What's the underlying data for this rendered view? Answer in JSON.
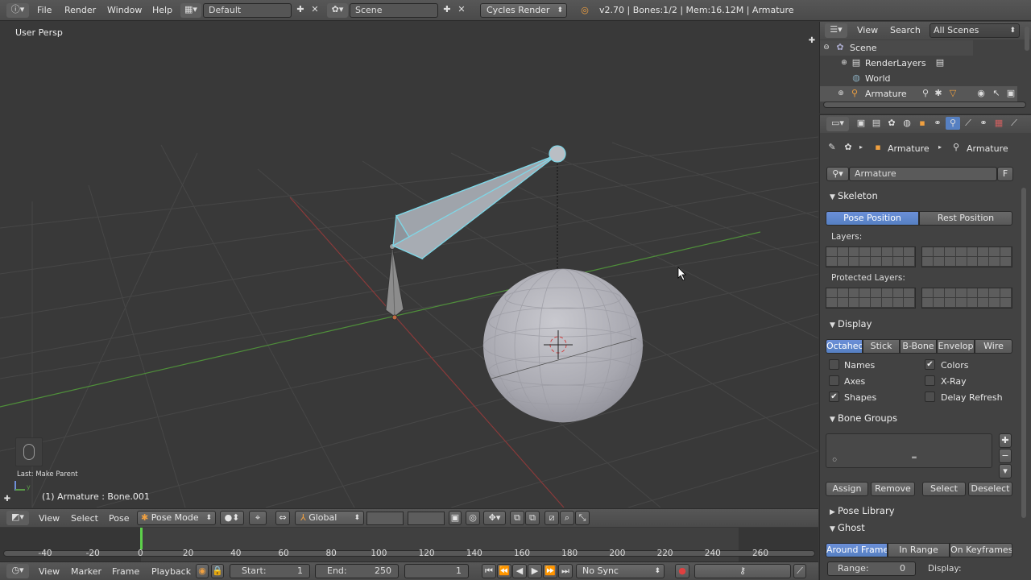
{
  "topbar": {
    "menus": [
      "File",
      "Render",
      "Window",
      "Help"
    ],
    "layout_name": "Default",
    "scene_name": "Scene",
    "render_engine": "Cycles Render",
    "stats": "v2.70 | Bones:1/2 | Mem:16.12M | Armature"
  },
  "viewport": {
    "view_label": "User Persp",
    "last_op": "Last: Make Parent",
    "object_info": "(1) Armature : Bone.001",
    "header": {
      "menus": [
        "View",
        "Select",
        "Pose"
      ],
      "mode": "Pose Mode",
      "orientation": "Global"
    }
  },
  "timeline": {
    "ticks": [
      "-40",
      "-20",
      "0",
      "20",
      "40",
      "60",
      "80",
      "100",
      "120",
      "140",
      "160",
      "180",
      "200",
      "220",
      "240",
      "260"
    ],
    "current_frame": 1,
    "menus": [
      "View",
      "Marker",
      "Frame",
      "Playback"
    ],
    "start_label": "Start:",
    "start_value": "1",
    "end_label": "End:",
    "end_value": "250",
    "frame_value": "1",
    "sync": "No Sync"
  },
  "outliner": {
    "menus": [
      "View",
      "Search"
    ],
    "filter": "All Scenes",
    "items": [
      "Scene",
      "RenderLayers",
      "World",
      "Armature"
    ]
  },
  "properties": {
    "breadcrumb": [
      "Armature",
      "Armature"
    ],
    "datablock_name": "Armature",
    "fake_user": "F",
    "skeleton": {
      "title": "Skeleton",
      "pose_position": "Pose Position",
      "rest_position": "Rest Position",
      "layers_label": "Layers:",
      "protected_label": "Protected Layers:"
    },
    "display": {
      "title": "Display",
      "types": [
        "Octahed",
        "Stick",
        "B-Bone",
        "Envelop",
        "Wire"
      ],
      "selected_type": "Octahed",
      "names": "Names",
      "axes": "Axes",
      "shapes": "Shapes",
      "colors": "Colors",
      "xray": "X-Ray",
      "delay_refresh": "Delay Refresh",
      "checked": {
        "names": false,
        "axes": false,
        "shapes": true,
        "colors": true,
        "xray": false,
        "delay_refresh": false
      }
    },
    "bone_groups": {
      "title": "Bone Groups",
      "assign": "Assign",
      "remove": "Remove",
      "select": "Select",
      "deselect": "Deselect"
    },
    "pose_library": {
      "title": "Pose Library"
    },
    "ghost": {
      "title": "Ghost",
      "modes": [
        "Around Frame",
        "In Range",
        "On Keyframes"
      ],
      "selected_mode": "Around Frame",
      "range_label": "Range:",
      "range_value": "0",
      "display_label": "Display:"
    }
  },
  "colors": {
    "accent": "#5680c2",
    "viewport_bg": "#393939",
    "bone_selected": "#7fd6e6",
    "x_axis": "#8a3a3a",
    "y_axis": "#4f8f3a"
  }
}
